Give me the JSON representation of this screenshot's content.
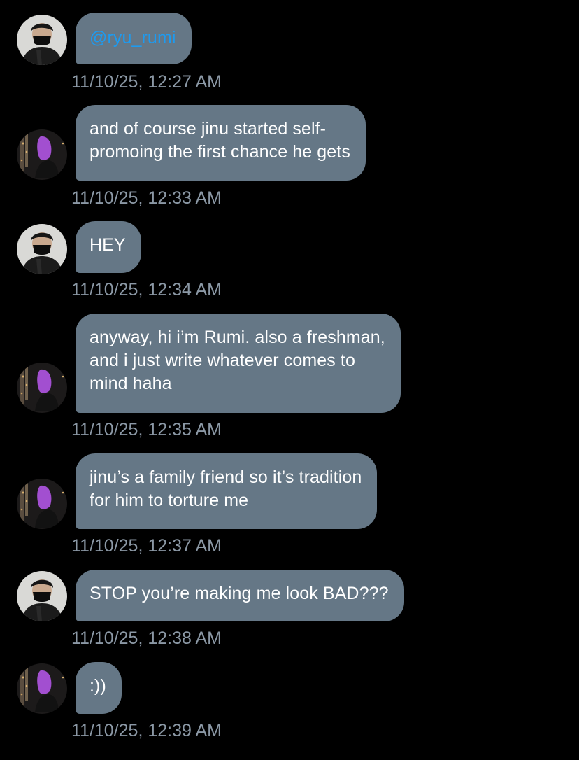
{
  "colors": {
    "background": "#000000",
    "bubble": "#657786",
    "bubble_text": "#ffffff",
    "link": "#1d9bf0",
    "timestamp": "#8b98a5"
  },
  "messages": [
    {
      "sender_avatar": "avatar-mask-user",
      "lines": [
        "@ryu_rumi"
      ],
      "is_link": true,
      "timestamp": "11/10/25, 12:27 AM"
    },
    {
      "sender_avatar": "avatar-purple-user",
      "lines": [
        "and of course jinu started self-",
        "promoing the first chance he gets"
      ],
      "timestamp": "11/10/25, 12:33 AM"
    },
    {
      "sender_avatar": "avatar-mask-user",
      "lines": [
        "HEY"
      ],
      "timestamp": "11/10/25, 12:34 AM"
    },
    {
      "sender_avatar": "avatar-purple-user",
      "lines": [
        "anyway, hi i’m Rumi. also a freshman,",
        "and i just write whatever comes to",
        "mind haha"
      ],
      "timestamp": "11/10/25, 12:35 AM"
    },
    {
      "sender_avatar": "avatar-purple-user",
      "lines": [
        "jinu’s a family friend so it’s tradition",
        "for him to torture me"
      ],
      "timestamp": "11/10/25, 12:37 AM"
    },
    {
      "sender_avatar": "avatar-mask-user",
      "lines": [
        "STOP you’re making me look BAD???"
      ],
      "timestamp": "11/10/25, 12:38 AM"
    },
    {
      "sender_avatar": "avatar-purple-user",
      "lines": [
        ":))"
      ],
      "timestamp": "11/10/25, 12:39 AM"
    }
  ]
}
